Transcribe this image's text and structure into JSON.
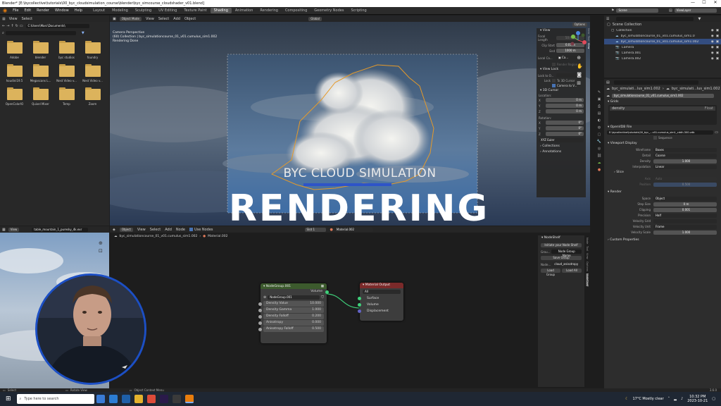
{
  "window": {
    "title": "Blender* [E:\\bycollective\\tutorials\\00_byc_cloudsimulation_course\\blender\\byc_simcourse_cloudshader_v01.blend]",
    "controls": [
      "—",
      "☐",
      "✕"
    ]
  },
  "menu": [
    "File",
    "Edit",
    "Render",
    "Window",
    "Help"
  ],
  "workspaces": [
    "Layout",
    "Modeling",
    "Sculpting",
    "UV Editing",
    "Texture Paint",
    "Shading",
    "Animation",
    "Rendering",
    "Compositing",
    "Geometry Nodes",
    "Scripting"
  ],
  "active_workspace": "Shading",
  "scene": {
    "label": "Scene",
    "view_layer": "ViewLayer"
  },
  "file_browser": {
    "header": [
      "View",
      "Select"
    ],
    "path": "C:\\Users\\Marc\\Documents\\",
    "folders": [
      "Adobe",
      "blender",
      "byc studios",
      "foundry",
      "houdini19.5",
      "Megascans L...",
      "Nest Video v...",
      "Nest Video v...",
      "OpenColorIO",
      "Quixel Mixer",
      "Temp",
      "Zoom"
    ]
  },
  "viewport": {
    "header": [
      "Object Mode",
      "View",
      "Select",
      "Add",
      "Object"
    ],
    "transform": "Global",
    "options": "Options",
    "info_lines": [
      "Camera Perspective",
      "(60) Collection | byc_simulationcourse_01_v01.cumulus_sim1.002",
      "Rendering Done"
    ],
    "overlay_subtitle": "BYC CLOUD SIMULATION",
    "overlay_title": "RENDERING"
  },
  "view_panel": {
    "title": "View",
    "focal_label": "Focal Length",
    "focal_value": "50 mm",
    "clip_start_label": "Clip Start",
    "clip_start": "0.01 m",
    "end_label": "End",
    "end": "1000 m",
    "local_camera_label": "Local Ca...",
    "render_region": "Render Region",
    "view_lock": "View Lock",
    "lock_obj": "Lock to O...",
    "lock": "Lock",
    "to_3d_cursor": "To 3D Cursor",
    "camera_to_view": "Camera to V...",
    "cursor_title": "3D Cursor",
    "location": "Location:",
    "x": "X",
    "y": "Y",
    "z": "Z",
    "loc_vals": [
      "0 m",
      "0 m",
      "0 m"
    ],
    "rotation": "Rotation:",
    "rot_vals": [
      "0°",
      "0°",
      "0°"
    ],
    "rot_mode": "XYZ Euler",
    "collections": "Collections",
    "annotations": "Annotations",
    "tabs": [
      "Item",
      "Tool",
      "View"
    ]
  },
  "outliner": {
    "title": "Scene Collection",
    "items": [
      {
        "label": "Collection",
        "indent": 1
      },
      {
        "label": "byc_simulationcourse_01_v01.cumulus_sim1.0",
        "indent": 2
      },
      {
        "label": "byc_simulationcourse_01_v01.cumulus_sim1.002",
        "indent": 2,
        "selected": true
      },
      {
        "label": "Camera",
        "indent": 2
      },
      {
        "label": "Camera.001",
        "indent": 2
      },
      {
        "label": "Camera.002",
        "indent": 2
      }
    ]
  },
  "properties": {
    "object_name": "byc_simulati...lus_sim1.002",
    "data_name": "byc_simulati...lus_sim1.002",
    "data_field": "byc_simulationcourse_01_v01.cumulus_sim1.002",
    "grids_title": "Grids",
    "grid_item": "density",
    "grid_type": "Float",
    "openvdb_title": "OpenVDB File",
    "vdb_path": "E:\\bycollective\\tutorials\\00_byc_...v01.cumulus_sim1_cddh.300.vdb",
    "sequence": "Sequence",
    "viewport_display": "Viewport Display",
    "wireframe_label": "Wireframe",
    "wireframe": "Boxes",
    "detail_label": "Detail",
    "detail": "Coarse",
    "density_label": "Density",
    "density": "1.000",
    "interp_label": "Interpolation",
    "interp": "Linear",
    "slice": "Slice",
    "axis_label": "Axis",
    "axis": "Auto",
    "position_label": "Position",
    "position": "0.500",
    "render_title": "Render",
    "space_label": "Space",
    "space": "Object",
    "step_label": "Step Size",
    "step": "0 m",
    "clipping_label": "Clipping",
    "clipping": "0.001",
    "precision_label": "Precision",
    "precision": "Half",
    "vgrid_label": "Velocity Grid",
    "vgrid": "",
    "vunit_label": "Velocity Unit",
    "vunit": "Frame",
    "vscale_label": "Velocity Scale",
    "vscale": "1.000",
    "custom": "Custom Properties"
  },
  "node_editor": {
    "header": [
      "Object",
      "View",
      "Select",
      "Add",
      "Node"
    ],
    "use_nodes": "Use Nodes",
    "slot": "Slot 1",
    "material": "Material.002",
    "breadcrumb": [
      "byc_simulationcourse_01_v01.cumulus_sim1.002",
      "Material.002"
    ],
    "group_node": {
      "title": "NodeGroup.001",
      "output": "Volume",
      "group_name": "NodeGroup.001",
      "inputs": [
        {
          "label": "Density Value",
          "value": "10.000"
        },
        {
          "label": "Density Gamma",
          "value": "1.000"
        },
        {
          "label": "Density Falloff",
          "value": "0.200"
        },
        {
          "label": "Anisotropy",
          "value": "0.000"
        },
        {
          "label": "Anisotropy Falloff",
          "value": "0.500"
        }
      ]
    },
    "output_node": {
      "title": "Material Output",
      "target": "All",
      "sockets": [
        "Surface",
        "Volume",
        "Displacement"
      ]
    },
    "sidebar": {
      "title": "NodeShelf",
      "initiate": "Initiate your Node Shelf",
      "group_label": "Grou...",
      "group_field": "Node Group Name",
      "save_group": "Save Group",
      "node_label": "Node...",
      "node_field": "cloud_anisotropy",
      "load_group": "Load Group",
      "load_all": "Load All",
      "tabs": [
        "Node",
        "Tool",
        "View",
        "Options",
        "NodeShelf"
      ]
    }
  },
  "image_editor": {
    "header": [
      "View"
    ],
    "image": "table_mountain_1_puresky_4k.exr"
  },
  "status_bar": {
    "select": "Select",
    "rotate": "Rotate View",
    "context": "Object Context Menu",
    "version": "3.6.0"
  },
  "taskbar": {
    "search": "Type here to search",
    "weather": "17°C  Mostly clear",
    "time": "10:32 PM",
    "date": "2023-10-21"
  },
  "colors": {
    "accent": "#4772b3",
    "cloud_outline": "#e59a2a",
    "node_group_header": "#3c5a2d",
    "output_header": "#7b2a2a"
  }
}
